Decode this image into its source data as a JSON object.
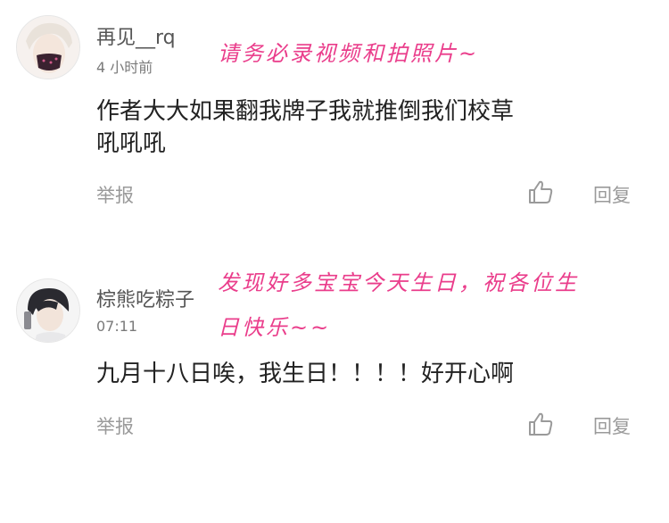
{
  "comments": [
    {
      "username": "再见__rq",
      "timestamp": "4 小时前",
      "text_lines": [
        "作者大大如果翻我牌子我就推倒我们校草",
        "吼吼吼"
      ],
      "report_label": "举报",
      "reply_label": "回复",
      "annotation_lines": [
        "请务必录视频和拍照片~"
      ]
    },
    {
      "username": "棕熊吃粽子",
      "timestamp": "07:11",
      "text_lines": [
        "九月十八日唉，我生日！！！！好开心啊"
      ],
      "report_label": "举报",
      "reply_label": "回复",
      "annotation_lines": [
        "发现好多宝宝今天生日，祝各位生",
        "日快乐~~"
      ]
    }
  ],
  "colors": {
    "annotation": "#ea3d8b",
    "meta": "#9a9a9a",
    "body": "#222222"
  },
  "icons": {
    "like": "thumbs-up-icon"
  }
}
